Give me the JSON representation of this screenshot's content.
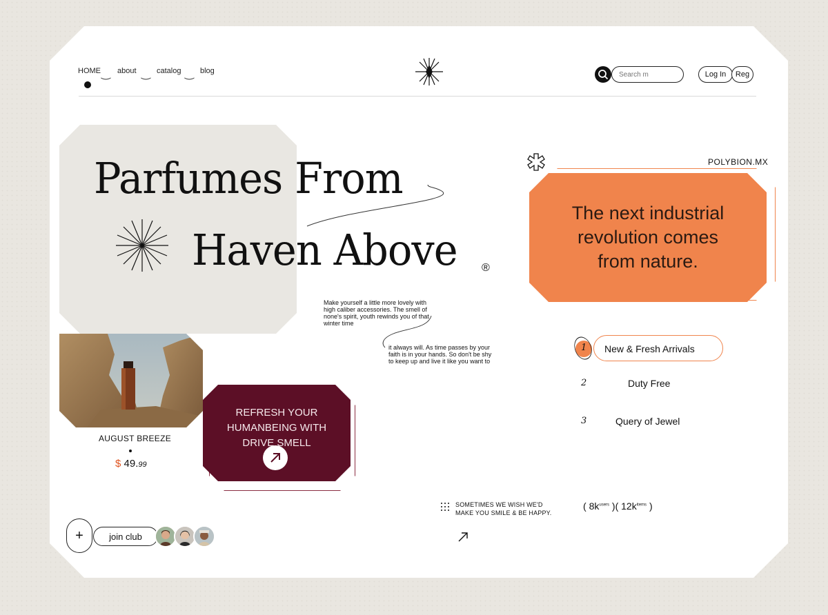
{
  "nav": {
    "home": "HOME",
    "about": "about",
    "catalog": "catalog",
    "blog": "blog"
  },
  "search": {
    "placeholder": "Search m"
  },
  "auth": {
    "login": "Log In",
    "register": "Reg"
  },
  "hero": {
    "line1": "Parfumes From",
    "line2": "Haven Above",
    "mark": "®"
  },
  "brand": {
    "site": "POLYBION.MX"
  },
  "orange_card": {
    "text": "The next industrial revolution comes from nature."
  },
  "para1": {
    "text": "Make yourself a little more lovely with high caliber accessories. The smell of none's spirit, youth rewinds you of that winter time"
  },
  "para2": {
    "text": "it always will. As time passes by your faith is in your hands. So don't be shy to keep up and live it like you want to"
  },
  "product": {
    "name": "AUGUST BREEZE",
    "currency": "$",
    "price_main": "49.",
    "price_cents": "99"
  },
  "promo": {
    "text": "REFRESH YOUR HUMANBEING WITH DRIVE SMELL"
  },
  "list": [
    {
      "num": "1",
      "label": "New & Fresh Arrivals"
    },
    {
      "num": "2",
      "label": "Duty Free"
    },
    {
      "num": "3",
      "label": "Query of Jewel"
    }
  ],
  "tagline": {
    "text": "SOMETIMES WE WISH WE'D MAKE YOU SMILE & BE HAPPY."
  },
  "stats": {
    "users_value": "8k",
    "users_label": "users",
    "items_value": "12k",
    "items_label": "items"
  },
  "club": {
    "join": "join club",
    "plus": "+"
  },
  "colors": {
    "orange": "#f0844c",
    "maroon": "#5c0f26",
    "beige": "#e9e7e2",
    "bg": "#e9e6e0"
  }
}
